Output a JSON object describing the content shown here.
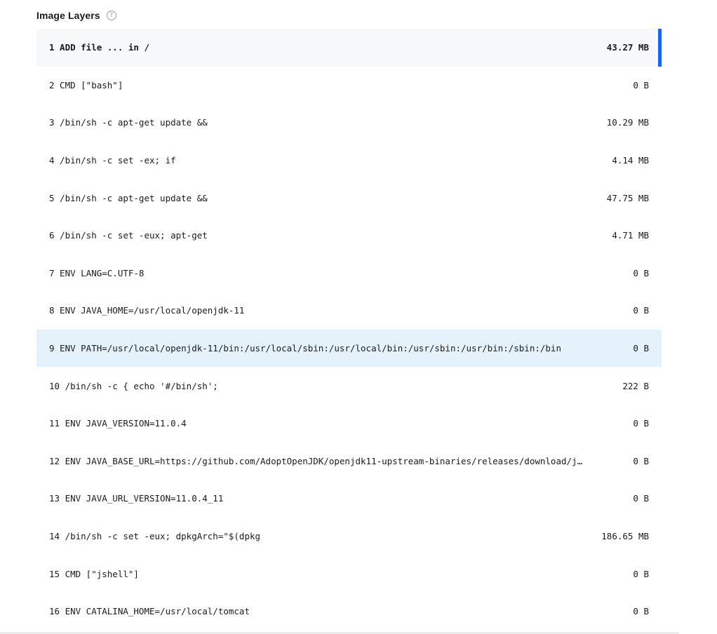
{
  "header": {
    "title": "Image Layers",
    "help_icon": "help-circle-icon"
  },
  "colors": {
    "selected_bg": "#f7f8f9",
    "selected_accent": "#1d63ed",
    "hover_bg": "#e5f2fc"
  },
  "layers": [
    {
      "command": "1 ADD file ... in /",
      "size": "43.27 MB",
      "state": "selected"
    },
    {
      "command": "2 CMD [\"bash\"]",
      "size": "0 B",
      "state": ""
    },
    {
      "command": "3 /bin/sh -c apt-get update &&",
      "size": "10.29 MB",
      "state": ""
    },
    {
      "command": "4 /bin/sh -c set -ex; if",
      "size": "4.14 MB",
      "state": ""
    },
    {
      "command": "5 /bin/sh -c apt-get update &&",
      "size": "47.75 MB",
      "state": ""
    },
    {
      "command": "6 /bin/sh -c set -eux; apt-get",
      "size": "4.71 MB",
      "state": ""
    },
    {
      "command": "7 ENV LANG=C.UTF-8",
      "size": "0 B",
      "state": ""
    },
    {
      "command": "8 ENV JAVA_HOME=/usr/local/openjdk-11",
      "size": "0 B",
      "state": ""
    },
    {
      "command": "9 ENV PATH=/usr/local/openjdk-11/bin:/usr/local/sbin:/usr/local/bin:/usr/sbin:/usr/bin:/sbin:/bin",
      "size": "0 B",
      "state": "hovered"
    },
    {
      "command": "10 /bin/sh -c { echo '#/bin/sh';",
      "size": "222 B",
      "state": ""
    },
    {
      "command": "11 ENV JAVA_VERSION=11.0.4",
      "size": "0 B",
      "state": ""
    },
    {
      "command": "12 ENV JAVA_BASE_URL=https://github.com/AdoptOpenJDK/openjdk11-upstream-binaries/releases/download/j…",
      "size": "0 B",
      "state": ""
    },
    {
      "command": "13 ENV JAVA_URL_VERSION=11.0.4_11",
      "size": "0 B",
      "state": ""
    },
    {
      "command": "14 /bin/sh -c set -eux; dpkgArch=\"$(dpkg",
      "size": "186.65 MB",
      "state": ""
    },
    {
      "command": "15 CMD [\"jshell\"]",
      "size": "0 B",
      "state": ""
    },
    {
      "command": "16 ENV CATALINA_HOME=/usr/local/tomcat",
      "size": "0 B",
      "state": ""
    }
  ]
}
